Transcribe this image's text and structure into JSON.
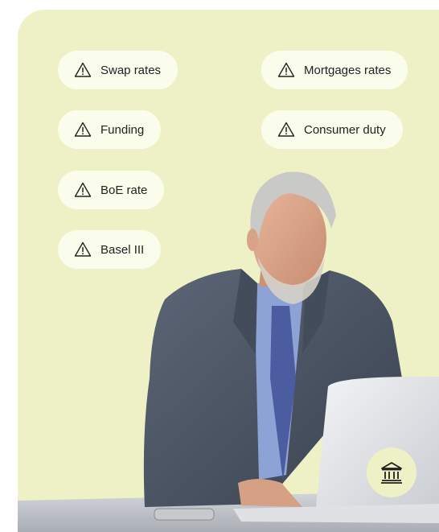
{
  "alerts": [
    {
      "label": "Swap rates",
      "icon": "warning-icon"
    },
    {
      "label": "Mortgages rates",
      "icon": "warning-icon"
    },
    {
      "label": "Funding",
      "icon": "warning-icon"
    },
    {
      "label": "Consumer duty",
      "icon": "warning-icon"
    },
    {
      "label": "BoE rate",
      "icon": "warning-icon"
    },
    {
      "label": "Basel III",
      "icon": "warning-icon"
    }
  ],
  "badge": {
    "icon": "bank-icon"
  },
  "colors": {
    "background": "#eef1c6",
    "chip_background": "#fbfdec",
    "text": "#222222",
    "suit": "#4a5564",
    "shirt": "#8da3d6",
    "tie": "#4b5ca0"
  }
}
